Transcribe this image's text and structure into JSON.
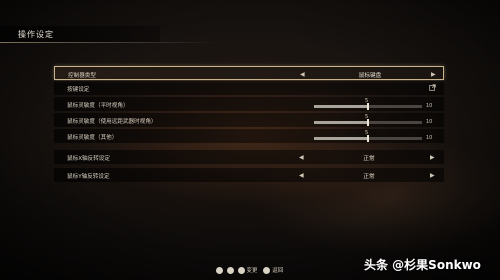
{
  "screen": {
    "title": "操作设定"
  },
  "settings": {
    "rows": [
      {
        "label": "控制器类型",
        "type": "select",
        "value": "鼠标键盘",
        "selected": true
      },
      {
        "label": "按键设定",
        "type": "link"
      },
      {
        "label": "鼠标灵敏度（平时视角）",
        "type": "slider",
        "value": "5",
        "max": "10",
        "fraction": 0.5
      },
      {
        "label": "鼠标灵敏度（使用远距武器时视角）",
        "type": "slider",
        "value": "5",
        "max": "10",
        "fraction": 0.5
      },
      {
        "label": "鼠标灵敏度（其他）",
        "type": "slider",
        "value": "5",
        "max": "10",
        "fraction": 0.5
      },
      {
        "label": "鼠标X轴反转设定",
        "type": "select",
        "value": "正常"
      },
      {
        "label": "鼠标Y轴反转设定",
        "type": "select",
        "value": "正常"
      }
    ],
    "arrows": {
      "left": "◀",
      "right": "▶"
    }
  },
  "footer": {
    "keys": [
      {
        "key": "",
        "label": ""
      },
      {
        "key": "",
        "label": ""
      },
      {
        "key": "",
        "label": "变更"
      },
      {
        "key": "",
        "label": "返回"
      }
    ]
  },
  "watermark": "头条 @杉果Sonkwo",
  "colors": {
    "accent_border": "#c9b48d",
    "text": "#d6cfc0"
  }
}
